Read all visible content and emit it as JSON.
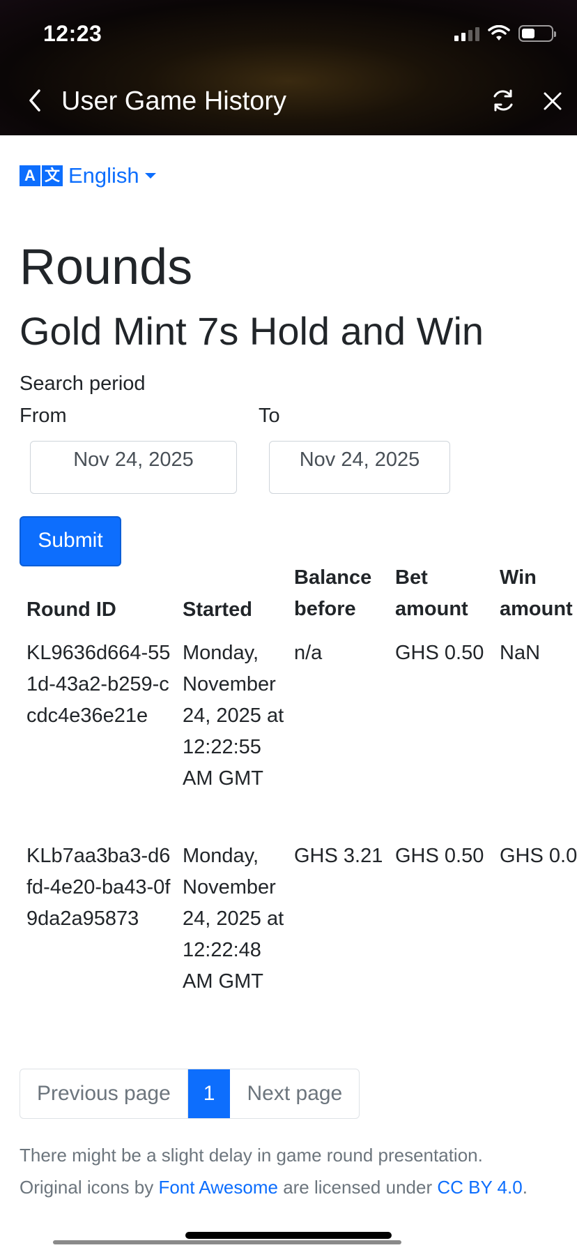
{
  "status_bar": {
    "time": "12:23"
  },
  "nav": {
    "title": "User Game History"
  },
  "lang": {
    "label": "English",
    "glyph_a": "A",
    "glyph_b": "文"
  },
  "page": {
    "heading": "Rounds",
    "game_title": "Gold Mint 7s Hold and Win",
    "search_period_label": "Search period",
    "from_label": "From",
    "to_label": "To",
    "from_value": "Nov 24, 2025",
    "to_value": "Nov 24, 2025",
    "submit_label": "Submit"
  },
  "table": {
    "headers": [
      "Round ID",
      "Started",
      "Balance before",
      "Bet amount",
      "Win amount"
    ],
    "rows": [
      {
        "round_id": "KL9636d664-551d-43a2-b259-ccdc4e36e21e",
        "started": "Monday, November 24, 2025 at 12:22:55 AM GMT",
        "balance_before": "n/a",
        "bet_amount": "GHS 0.50",
        "win_amount": "NaN"
      },
      {
        "round_id": "KLb7aa3ba3-d6fd-4e20-ba43-0f9da2a95873",
        "started": "Monday, November 24, 2025 at 12:22:48 AM GMT",
        "balance_before": "GHS 3.21",
        "bet_amount": "GHS 0.50",
        "win_amount": "GHS 0.0"
      }
    ]
  },
  "pager": {
    "prev": "Previous page",
    "current": "1",
    "next": "Next page"
  },
  "footer": {
    "delay_note": "There might be a slight delay in game round presentation.",
    "icons_prefix": "Original icons by",
    "icons_link": "Font Awesome",
    "icons_mid": "are licensed under",
    "license_link": "CC BY 4.0",
    "icons_suffix": "."
  },
  "colors": {
    "accent": "#0d6efd",
    "text": "#212529",
    "muted": "#6c757d"
  }
}
